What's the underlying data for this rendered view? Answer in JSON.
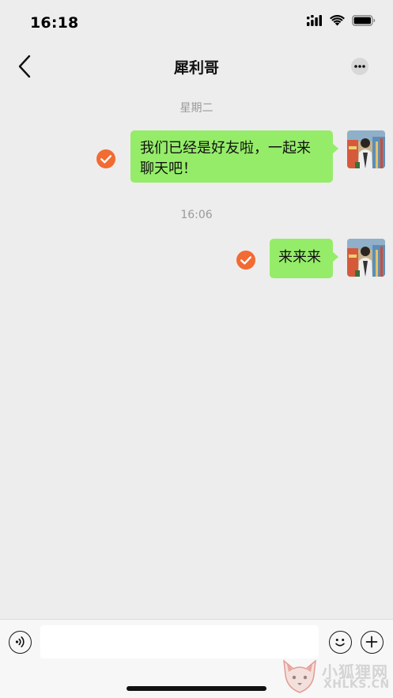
{
  "status_bar": {
    "time": "16:18",
    "icons": [
      "cellular-signal-icon",
      "wifi-icon",
      "battery-icon"
    ]
  },
  "header": {
    "title": "犀利哥",
    "back_icon": "chevron-left-icon",
    "more_icon": "more-dots-icon"
  },
  "messages": [
    {
      "timestamp": "星期二",
      "text_line1": "我们已经是好友啦，一起来",
      "text_line2": "聊天吧！",
      "status_icon": "check-circle-icon"
    },
    {
      "timestamp": "16:06",
      "text": "来来来",
      "status_icon": "check-circle-icon"
    }
  ],
  "input_bar": {
    "voice_icon": "voice-icon",
    "placeholder": "",
    "value": "",
    "emoji_icon": "smile-icon",
    "plus_icon": "plus-icon"
  },
  "watermark": {
    "text_cn": "小狐狸网",
    "text_en": "XHLKS.CN"
  },
  "colors": {
    "background": "#ededed",
    "bubble_green": "#95ec69",
    "check_orange": "#f26b32",
    "timestamp_gray": "#9a9a9a"
  }
}
